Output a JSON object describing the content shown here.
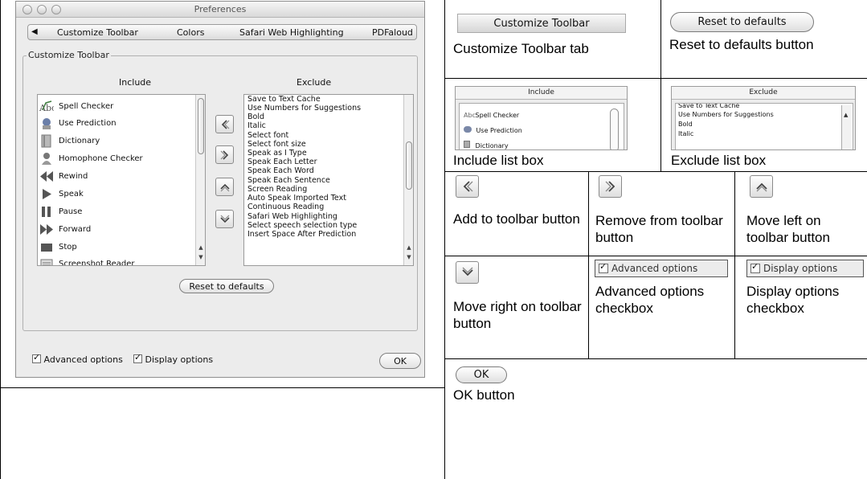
{
  "window": {
    "title": "Preferences",
    "tabs": [
      "Customize Toolbar",
      "Colors",
      "Safari Web Highlighting",
      "PDFaloud"
    ],
    "group_title": "Customize Toolbar",
    "include_header": "Include",
    "exclude_header": "Exclude",
    "include_items": [
      {
        "label": "Spell Checker",
        "icon": "spell-checker-icon"
      },
      {
        "label": "Use Prediction",
        "icon": "prediction-icon"
      },
      {
        "label": "Dictionary",
        "icon": "dictionary-icon"
      },
      {
        "label": "Homophone Checker",
        "icon": "homophone-icon"
      },
      {
        "label": "Rewind",
        "icon": "rewind-icon"
      },
      {
        "label": "Speak",
        "icon": "speak-icon"
      },
      {
        "label": "Pause",
        "icon": "pause-icon"
      },
      {
        "label": "Forward",
        "icon": "forward-icon"
      },
      {
        "label": "Stop",
        "icon": "stop-icon"
      },
      {
        "label": "Screenshot Reader",
        "icon": "screenshot-reader-icon"
      }
    ],
    "exclude_items": [
      "Save to Text Cache",
      "Use Numbers for Suggestions",
      "Bold",
      "Italic",
      "Select font",
      "Select font size",
      "Speak as I Type",
      "Speak Each Letter",
      "Speak Each Word",
      "Speak Each Sentence",
      "Screen Reading",
      "Auto Speak Imported Text",
      "Continuous Reading",
      "Safari Web Highlighting",
      "Select speech selection type",
      "Insert Space After Prediction"
    ],
    "reset_button": "Reset to defaults",
    "advanced_options": "Advanced options",
    "display_options": "Display options",
    "ok_button": "OK"
  },
  "captions": {
    "customize_tab": "Customize Toolbar tab",
    "reset_button": "Reset to defaults button",
    "include_list": "Include list box",
    "exclude_list": "Exclude list box",
    "add_button": "Add to toolbar button",
    "remove_button": "Remove from toolbar button",
    "move_left_button": "Move left on toolbar button",
    "move_right_button": "Move right on toolbar button",
    "advanced_checkbox": "Advanced options checkbox",
    "display_checkbox": "Display options checkbox",
    "ok_button": "OK button"
  },
  "crops": {
    "tab_label": "Customize Toolbar",
    "reset_label": "Reset to defaults",
    "include_header": "Include",
    "include_items": [
      "Spell Checker",
      "Use Prediction",
      "Dictionary"
    ],
    "exclude_header": "Exclude",
    "exclude_items": [
      "Save to Text Cache",
      "Use Numbers for Suggestions",
      "Bold",
      "Italic"
    ],
    "advanced_label": "Advanced options",
    "display_label": "Display options",
    "ok_label": "OK"
  }
}
